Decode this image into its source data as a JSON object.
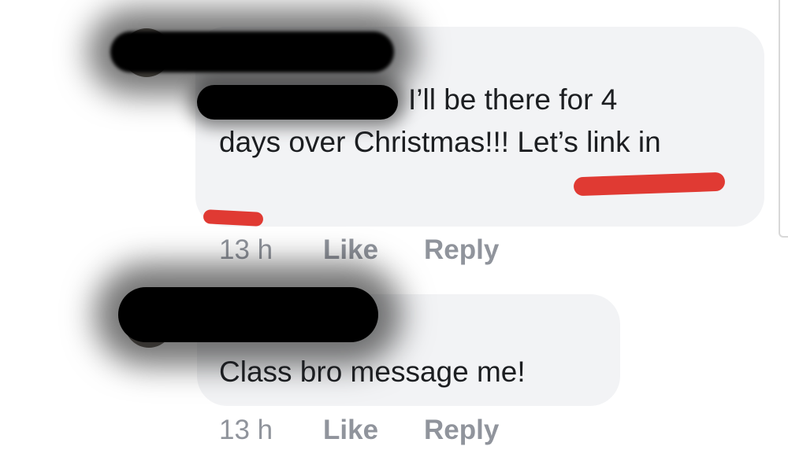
{
  "comments": [
    {
      "text_line1": "I’ll be there for 4",
      "text_rest": "days over Christmas!!! Let’s link in",
      "time": "13 h",
      "like_label": "Like",
      "reply_label": "Reply"
    },
    {
      "text": "Class bro message me!",
      "time": "13 h",
      "like_label": "Like",
      "reply_label": "Reply"
    }
  ],
  "colors": {
    "bubble": "#f2f3f5",
    "text": "#1c1e21",
    "meta": "#90949c",
    "annotation": "#e03a33",
    "redaction": "#000000"
  }
}
